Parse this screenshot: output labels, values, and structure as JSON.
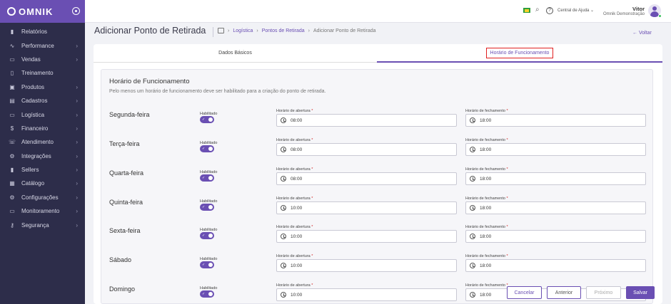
{
  "brand": {
    "name": "omnik"
  },
  "sidebar": {
    "items": [
      {
        "label": "Relatórios",
        "icon": "bar-chart-icon",
        "chevron": false
      },
      {
        "label": "Performance",
        "icon": "pulse-icon",
        "chevron": true
      },
      {
        "label": "Vendas",
        "icon": "cart-icon",
        "chevron": true
      },
      {
        "label": "Treinamento",
        "icon": "book-icon",
        "chevron": false
      },
      {
        "label": "Produtos",
        "icon": "box-icon",
        "chevron": true
      },
      {
        "label": "Cadastros",
        "icon": "id-card-icon",
        "chevron": true
      },
      {
        "label": "Logística",
        "icon": "truck-icon",
        "chevron": true
      },
      {
        "label": "Financeiro",
        "icon": "dollar-icon",
        "chevron": true
      },
      {
        "label": "Atendimento",
        "icon": "phone-icon",
        "chevron": true
      },
      {
        "label": "Integrações",
        "icon": "gear-icon",
        "chevron": true
      },
      {
        "label": "Sellers",
        "icon": "bars-icon",
        "chevron": true
      },
      {
        "label": "Catálogo",
        "icon": "catalog-icon",
        "chevron": true
      },
      {
        "label": "Configurações",
        "icon": "cog-icon",
        "chevron": true
      },
      {
        "label": "Monitoramento",
        "icon": "monitor-icon",
        "chevron": true
      },
      {
        "label": "Segurança",
        "icon": "key-icon",
        "chevron": true
      }
    ]
  },
  "topbar": {
    "help_label": "Central de Ajuda",
    "user_name": "Vitor",
    "user_company": "Omnik Demonstração"
  },
  "header": {
    "title": "Adicionar Ponto de Retirada",
    "breadcrumb": [
      "Logística",
      "Pontos de Retirada",
      "Adicionar Ponto de Retirada"
    ],
    "back_label": "Voltar"
  },
  "tabs": [
    {
      "label": "Dados Básicos",
      "active": false
    },
    {
      "label": "Horário de Funcionamento",
      "active": true
    }
  ],
  "panel": {
    "title": "Horário de Funcionamento",
    "description": "Pelo menos um horário de funcionamento deve ser habilitado para a criação do ponto de retirada.",
    "enabled_label": "Habilitado",
    "open_label": "Horário de abertura",
    "close_label": "Horário de fechamento",
    "required_mark": "*",
    "days": [
      {
        "name": "Segunda-feira",
        "enabled": true,
        "open": "08:00",
        "close": "18:00"
      },
      {
        "name": "Terça-feira",
        "enabled": true,
        "open": "08:00",
        "close": "18:00"
      },
      {
        "name": "Quarta-feira",
        "enabled": true,
        "open": "08:00",
        "close": "18:00"
      },
      {
        "name": "Quinta-feira",
        "enabled": true,
        "open": "10:00",
        "close": "18:00"
      },
      {
        "name": "Sexta-feira",
        "enabled": true,
        "open": "10:00",
        "close": "18:00"
      },
      {
        "name": "Sábado",
        "enabled": true,
        "open": "10:00",
        "close": "18:00"
      },
      {
        "name": "Domingo",
        "enabled": true,
        "open": "10:00",
        "close": "18:00"
      }
    ]
  },
  "footer": {
    "cancel": "Cancelar",
    "previous": "Anterior",
    "next": "Próximo",
    "save": "Salvar"
  },
  "colors": {
    "brand": "#6a4fb3",
    "sidebar": "#2d2d4a",
    "highlight": "#e02020"
  }
}
